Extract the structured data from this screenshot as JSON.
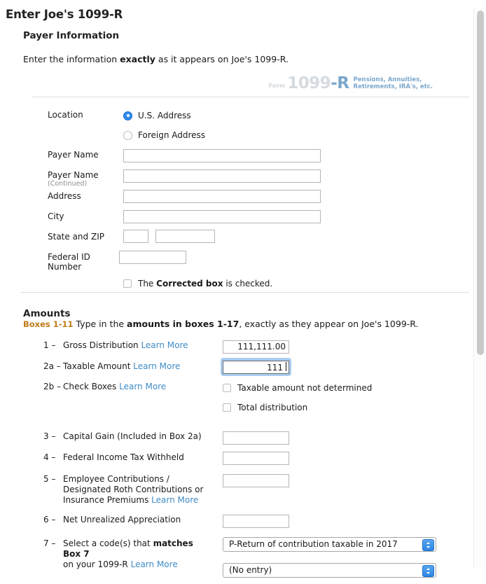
{
  "page": {
    "title": "Enter Joe's 1099-R"
  },
  "payer_section": {
    "heading": "Payer Information",
    "intro_before": "Enter the information ",
    "intro_bold": "exactly",
    "intro_after": " as it appears on Joe's 1099-R.",
    "form_logo": {
      "form_word": "Form",
      "number": "1099",
      "suffix": "-R",
      "desc_line1": "Pensions, Annuities,",
      "desc_line2": "Retirements, IRA's, etc.",
      "number_color": "#d5dbe0",
      "suffix_color": "#7ba7cc",
      "desc_color": "#7ba7cc"
    },
    "fields": {
      "location_label": "Location",
      "location_options": [
        {
          "label": "U.S. Address",
          "selected": true
        },
        {
          "label": "Foreign Address",
          "selected": false
        }
      ],
      "payer_name_label": "Payer Name",
      "payer_name_value": "",
      "payer_name_cont_label": "Payer Name",
      "payer_name_cont_sub": "(Continued)",
      "payer_name_cont_value": "",
      "address_label": "Address",
      "address_value": "",
      "city_label": "City",
      "city_value": "",
      "state_zip_label": "State and ZIP",
      "state_value": "",
      "zip_value": "",
      "federal_id_label": "Federal ID Number",
      "federal_id_value": "",
      "corrected_before": "The ",
      "corrected_bold": "Corrected box",
      "corrected_after": " is checked.",
      "corrected_checked": false
    }
  },
  "amounts_section": {
    "heading": "Amounts",
    "intro_tag": "Boxes 1-11",
    "intro_before": " Type in the ",
    "intro_bold": "amounts in boxes 1-17",
    "intro_after": ", exactly as they appear on Joe's 1099-R.",
    "tag_color": "#c07a18",
    "learn_more": "Learn More",
    "rows": [
      {
        "number": "1 –",
        "label": "Gross Distribution ",
        "has_learn_more": true,
        "value": "111,111.00",
        "focused": false
      },
      {
        "number": "2a –",
        "label": "Taxable Amount ",
        "has_learn_more": true,
        "value": "111",
        "focused": true
      },
      {
        "number": "2b –",
        "label": "Check Boxes ",
        "has_learn_more": true,
        "checkboxes": [
          {
            "label": "Taxable amount not determined",
            "checked": false
          },
          {
            "label": "Total distribution",
            "checked": false
          }
        ]
      },
      {
        "number": "3 –",
        "label": "Capital Gain (Included in Box 2a)",
        "has_learn_more": false,
        "value": "",
        "focused": false
      },
      {
        "number": "4 –",
        "label": "Federal Income Tax Withheld",
        "has_learn_more": false,
        "value": "",
        "focused": false
      },
      {
        "number": "5 –",
        "label": "Employee Contributions / Designated Roth Contributions or Insurance Premiums ",
        "has_learn_more": true,
        "value": "",
        "focused": false
      },
      {
        "number": "6 –",
        "label": "Net Unrealized Appreciation",
        "has_learn_more": false,
        "value": "",
        "focused": false
      },
      {
        "number": "7 –",
        "label_part1": "Select a code(s) that ",
        "label_bold": "matches Box 7",
        "label_part2": "on your 1099-R ",
        "has_learn_more": true,
        "select1_value": "P-Return of contribution taxable in 2017",
        "select2_value": "(No entry)"
      }
    ]
  },
  "scrollbar": {
    "thumb_color": "#c9c9c9"
  }
}
